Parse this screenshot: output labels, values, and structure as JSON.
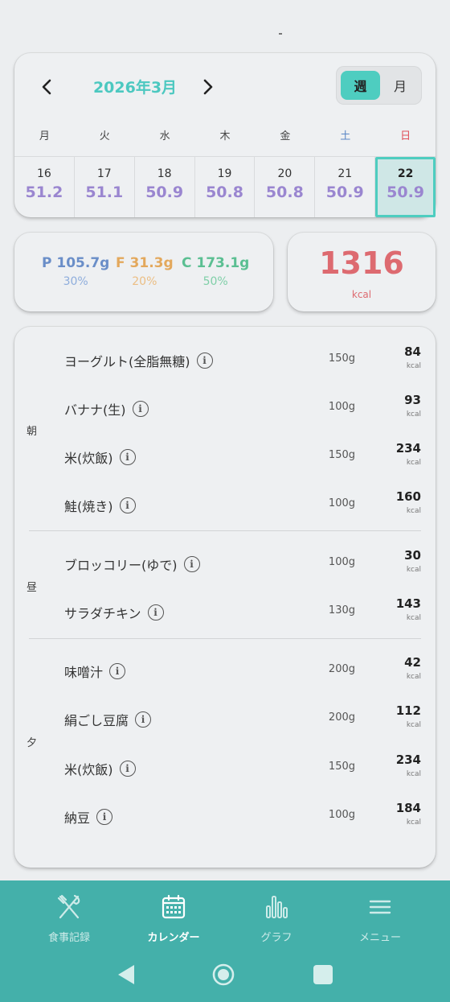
{
  "calendar": {
    "month_title": "2026年3月",
    "view_toggle": {
      "week": "週",
      "month": "月",
      "selected": "週"
    },
    "weekdays": [
      "月",
      "火",
      "水",
      "木",
      "金",
      "土",
      "日"
    ],
    "days": [
      {
        "day": "16",
        "weight": "51.2"
      },
      {
        "day": "17",
        "weight": "51.1"
      },
      {
        "day": "18",
        "weight": "50.9"
      },
      {
        "day": "19",
        "weight": "50.8"
      },
      {
        "day": "20",
        "weight": "50.8"
      },
      {
        "day": "21",
        "weight": "50.9"
      },
      {
        "day": "22",
        "weight": "50.9"
      }
    ],
    "selected_day": "22"
  },
  "macros": {
    "protein": {
      "value": "P 105.7g",
      "pct": "30%"
    },
    "fat": {
      "value": "F 31.3g",
      "pct": "20%"
    },
    "carbs": {
      "value": "C 173.1g",
      "pct": "50%"
    }
  },
  "total": {
    "kcal": "1316",
    "unit": "kcal"
  },
  "meals": [
    {
      "label": "朝",
      "items": [
        {
          "name": "ヨーグルト(全脂無糖)",
          "amount": "150g",
          "kcal": "84",
          "unit": "kcal"
        },
        {
          "name": "バナナ(生)",
          "amount": "100g",
          "kcal": "93",
          "unit": "kcal"
        },
        {
          "name": "米(炊飯)",
          "amount": "150g",
          "kcal": "234",
          "unit": "kcal"
        },
        {
          "name": "鮭(焼き)",
          "amount": "100g",
          "kcal": "160",
          "unit": "kcal"
        }
      ]
    },
    {
      "label": "昼",
      "items": [
        {
          "name": "ブロッコリー(ゆで)",
          "amount": "100g",
          "kcal": "30",
          "unit": "kcal"
        },
        {
          "name": "サラダチキン",
          "amount": "130g",
          "kcal": "143",
          "unit": "kcal"
        }
      ]
    },
    {
      "label": "夕",
      "items": [
        {
          "name": "味噌汁",
          "amount": "200g",
          "kcal": "42",
          "unit": "kcal"
        },
        {
          "name": "絹ごし豆腐",
          "amount": "200g",
          "kcal": "112",
          "unit": "kcal"
        },
        {
          "name": "米(炊飯)",
          "amount": "150g",
          "kcal": "234",
          "unit": "kcal"
        },
        {
          "name": "納豆",
          "amount": "100g",
          "kcal": "184",
          "unit": "kcal"
        }
      ]
    }
  ],
  "bottom_nav": {
    "tabs": [
      {
        "label": "食事記録",
        "icon": "fork-knife-icon"
      },
      {
        "label": "カレンダー",
        "icon": "calendar-icon"
      },
      {
        "label": "グラフ",
        "icon": "bar-chart-icon"
      },
      {
        "label": "メニュー",
        "icon": "menu-icon"
      }
    ],
    "active": "カレンダー"
  },
  "colors": {
    "accent": "#4ecdc0",
    "nav_bg": "#44b0aa",
    "weight": "#9a86d0",
    "protein": "#6a8ec8",
    "fat": "#e3a85c",
    "carbs": "#5bbf92",
    "kcal": "#dd6a70"
  }
}
